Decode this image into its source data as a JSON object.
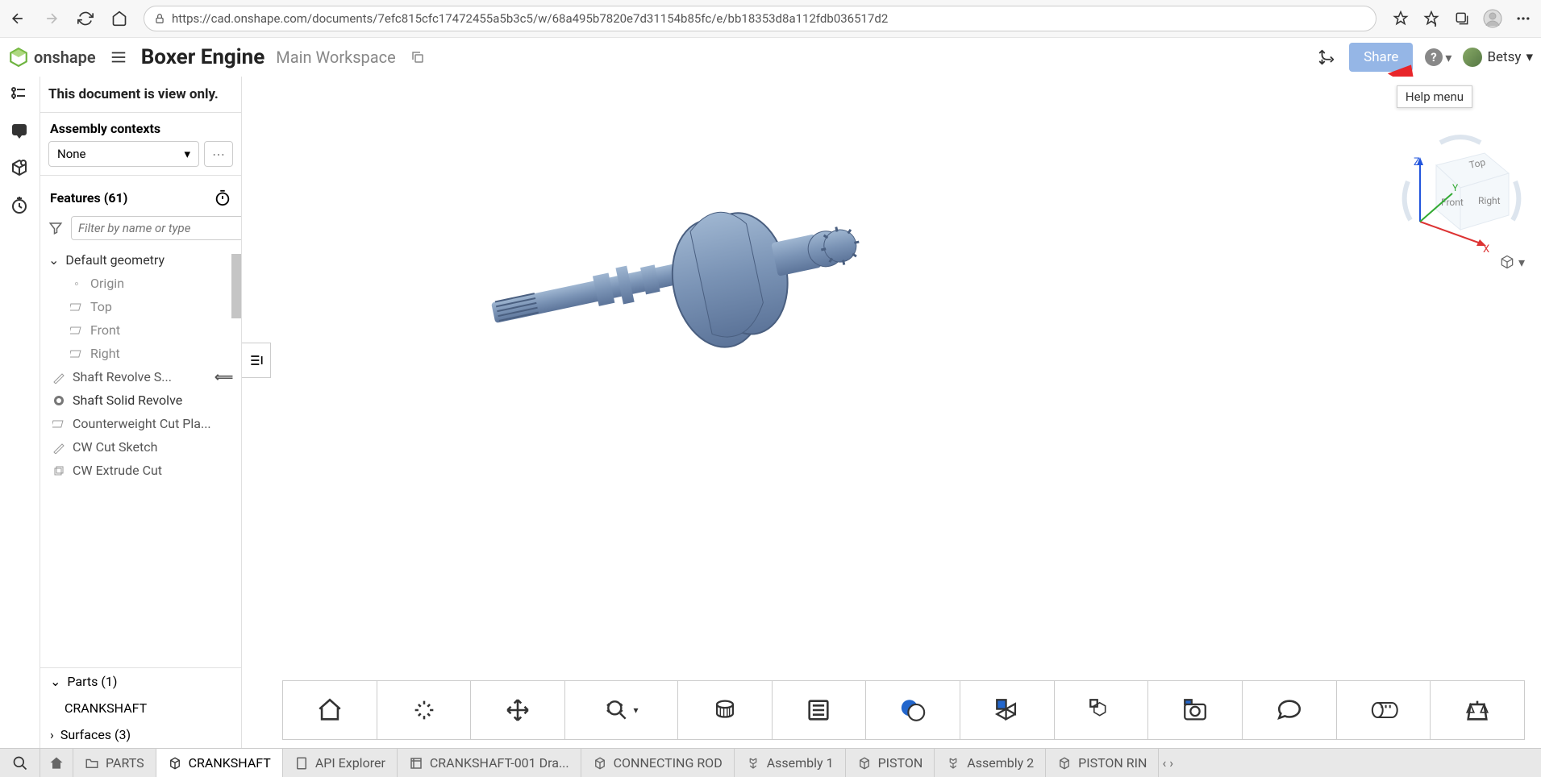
{
  "browser": {
    "url": "https://cad.onshape.com/documents/7efc815cfc17472455a5b3c5/w/68a495b7820e7d31154b85fc/e/bb18353d8a112fdb036517d2"
  },
  "header": {
    "brand": "onshape",
    "doc_title": "Boxer Engine",
    "workspace": "Main Workspace",
    "share_label": "Share",
    "user_name": "Betsy"
  },
  "tooltip": {
    "help_menu": "Help menu"
  },
  "panel": {
    "view_only_banner": "This document is view only.",
    "assembly_contexts_header": "Assembly contexts",
    "assembly_context_value": "None",
    "features_header": "Features (61)",
    "filter_placeholder": "Filter by name or type",
    "default_geometry_label": "Default geometry",
    "geom_origin": "Origin",
    "geom_top": "Top",
    "geom_front": "Front",
    "geom_right": "Right",
    "feat_shaft_revolve_sketch": "Shaft Revolve S...",
    "feat_shaft_solid_revolve": "Shaft Solid Revolve",
    "feat_cw_cut_plane": "Counterweight Cut Pla...",
    "feat_cw_cut_sketch": "CW Cut Sketch",
    "feat_cw_extrude_cut": "CW Extrude Cut",
    "parts_header": "Parts (1)",
    "part_crankshaft": "CRANKSHAFT",
    "surfaces_header": "Surfaces (3)"
  },
  "viewcube": {
    "top": "Top",
    "front": "Front",
    "right": "Right",
    "x": "X",
    "y": "Y",
    "z": "Z"
  },
  "tabs": {
    "parts": "PARTS",
    "crankshaft": "CRANKSHAFT",
    "api_explorer": "API Explorer",
    "crankshaft_drawing": "CRANKSHAFT-001 Dra...",
    "connecting_rod": "CONNECTING ROD",
    "assembly1": "Assembly 1",
    "piston": "PISTON",
    "assembly2": "Assembly 2",
    "piston_ring": "PISTON RIN"
  }
}
